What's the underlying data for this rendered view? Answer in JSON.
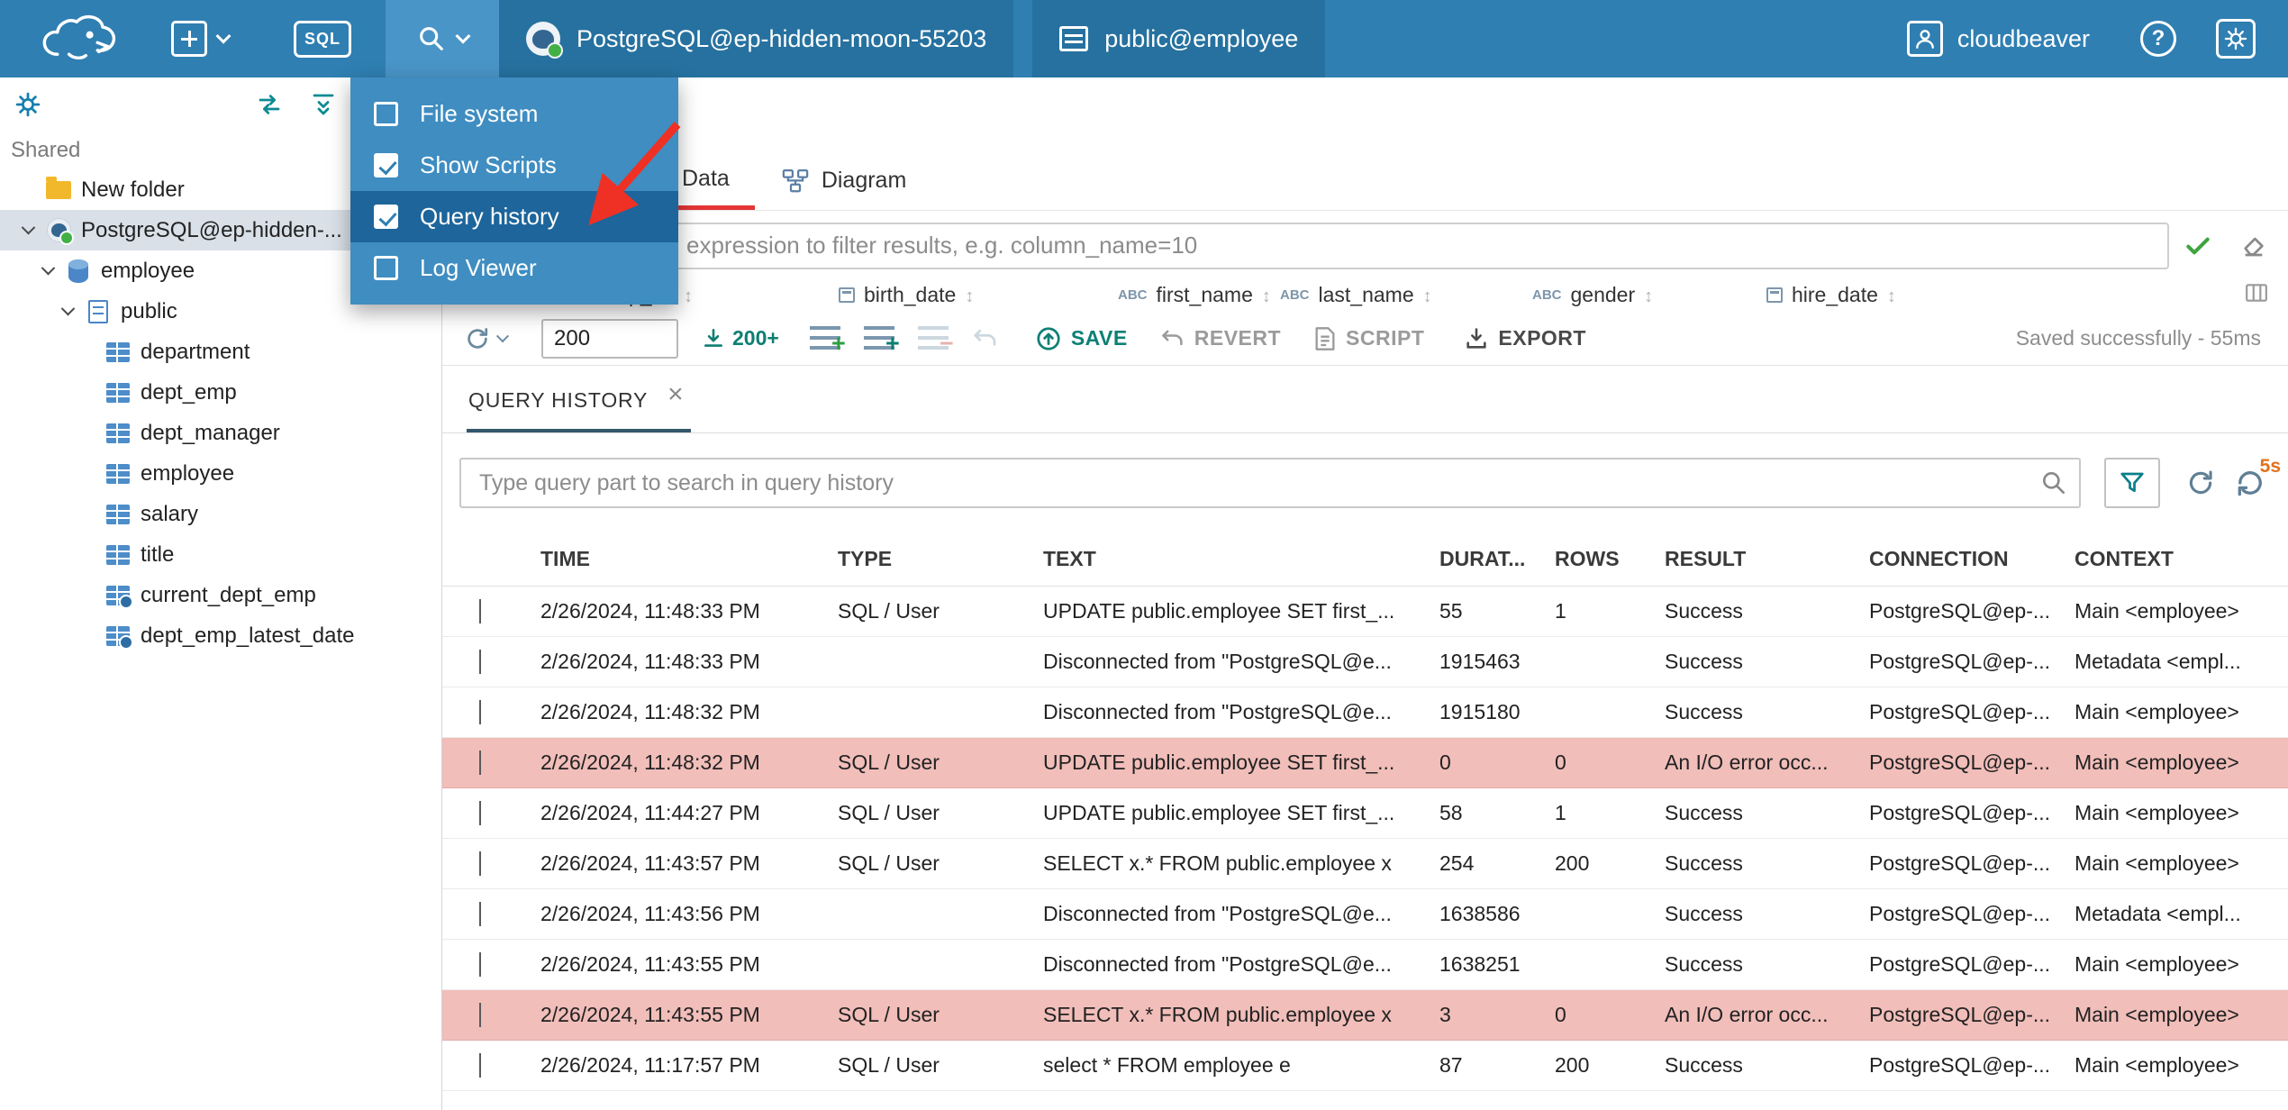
{
  "colors": {
    "topbar": "#2f7fb2",
    "topbar_active_segment": "#26719f",
    "menu_highlight": "#1d659b",
    "active_tab_underline": "#e53535",
    "teal_accent": "#0e8074",
    "error_row_background": "#f1beba",
    "annotation_arrow": "#ee3124"
  },
  "topbar": {
    "sql_button": "SQL",
    "connection_label": "PostgreSQL@ep-hidden-moon-55203",
    "schema_label": "public@employee",
    "username": "cloudbeaver",
    "help": "?"
  },
  "menu": {
    "items": [
      {
        "label": "File system",
        "checked": false,
        "highlighted": false
      },
      {
        "label": "Show Scripts",
        "checked": true,
        "highlighted": false
      },
      {
        "label": "Query history",
        "checked": true,
        "highlighted": true
      },
      {
        "label": "Log Viewer",
        "checked": false,
        "highlighted": false
      }
    ]
  },
  "sidebar": {
    "section": "Shared",
    "tree": [
      {
        "label": "New folder",
        "icon": "folder",
        "level": 0,
        "chevron": false,
        "selected": false
      },
      {
        "label": "PostgreSQL@ep-hidden-...",
        "icon": "postgres",
        "level": 0,
        "chevron": true,
        "selected": true
      },
      {
        "label": "employee",
        "icon": "database",
        "level": 1,
        "chevron": true,
        "selected": false
      },
      {
        "label": "public",
        "icon": "schema",
        "level": 2,
        "chevron": true,
        "selected": false
      },
      {
        "label": "department",
        "icon": "table",
        "level": 3,
        "chevron": false,
        "selected": false
      },
      {
        "label": "dept_emp",
        "icon": "table",
        "level": 3,
        "chevron": false,
        "selected": false
      },
      {
        "label": "dept_manager",
        "icon": "table",
        "level": 3,
        "chevron": false,
        "selected": false
      },
      {
        "label": "employee",
        "icon": "table",
        "level": 3,
        "chevron": false,
        "selected": false
      },
      {
        "label": "salary",
        "icon": "table",
        "level": 3,
        "chevron": false,
        "selected": false
      },
      {
        "label": "title",
        "icon": "table",
        "level": 3,
        "chevron": false,
        "selected": false
      },
      {
        "label": "current_dept_emp",
        "icon": "view",
        "level": 3,
        "chevron": false,
        "selected": false
      },
      {
        "label": "dept_emp_latest_date",
        "icon": "view",
        "level": 3,
        "chevron": false,
        "selected": false
      }
    ]
  },
  "tabs": {
    "data": "Data",
    "diagram": "Diagram"
  },
  "filter": {
    "placeholder": "expression to filter results, e.g. column_name=10"
  },
  "result_grid": {
    "row_number_header": "#",
    "columns": [
      {
        "name": "emp_no",
        "type": "num"
      },
      {
        "name": "birth_date",
        "type": "date"
      },
      {
        "name": "first_name",
        "type": "text"
      },
      {
        "name": "last_name",
        "type": "text"
      },
      {
        "name": "gender",
        "type": "text"
      },
      {
        "name": "hire_date",
        "type": "date"
      }
    ]
  },
  "toolbar": {
    "limit_value": "200",
    "fetch_more": "200+",
    "save": "SAVE",
    "revert": "REVERT",
    "script": "SCRIPT",
    "export": "EXPORT",
    "status": "Saved successfully - 55ms"
  },
  "history": {
    "tab_label": "QUERY HISTORY",
    "close_icon": "×",
    "search_placeholder": "Type query part to search in query history",
    "refresh_badge": "5s",
    "columns": [
      "TIME",
      "TYPE",
      "TEXT",
      "DURAT...",
      "ROWS",
      "RESULT",
      "CONNECTION",
      "CONTEXT"
    ],
    "rows": [
      {
        "time": "2/26/2024, 11:48:33 PM",
        "type": "SQL / User",
        "text": "UPDATE public.employee SET first_...",
        "duration": "55",
        "rows": "1",
        "result": "Success",
        "connection": "PostgreSQL@ep-...",
        "context": "Main <employee>",
        "error": false
      },
      {
        "time": "2/26/2024, 11:48:33 PM",
        "type": "",
        "text": "Disconnected from \"PostgreSQL@e...",
        "duration": "1915463",
        "rows": "",
        "result": "Success",
        "connection": "PostgreSQL@ep-...",
        "context": "Metadata <empl...",
        "error": false
      },
      {
        "time": "2/26/2024, 11:48:32 PM",
        "type": "",
        "text": "Disconnected from \"PostgreSQL@e...",
        "duration": "1915180",
        "rows": "",
        "result": "Success",
        "connection": "PostgreSQL@ep-...",
        "context": "Main <employee>",
        "error": false
      },
      {
        "time": "2/26/2024, 11:48:32 PM",
        "type": "SQL / User",
        "text": "UPDATE public.employee SET first_...",
        "duration": "0",
        "rows": "0",
        "result": "An I/O error occ...",
        "connection": "PostgreSQL@ep-...",
        "context": "Main <employee>",
        "error": true
      },
      {
        "time": "2/26/2024, 11:44:27 PM",
        "type": "SQL / User",
        "text": "UPDATE public.employee SET first_...",
        "duration": "58",
        "rows": "1",
        "result": "Success",
        "connection": "PostgreSQL@ep-...",
        "context": "Main <employee>",
        "error": false
      },
      {
        "time": "2/26/2024, 11:43:57 PM",
        "type": "SQL / User",
        "text": "SELECT x.* FROM public.employee x",
        "duration": "254",
        "rows": "200",
        "result": "Success",
        "connection": "PostgreSQL@ep-...",
        "context": "Main <employee>",
        "error": false
      },
      {
        "time": "2/26/2024, 11:43:56 PM",
        "type": "",
        "text": "Disconnected from \"PostgreSQL@e...",
        "duration": "1638586",
        "rows": "",
        "result": "Success",
        "connection": "PostgreSQL@ep-...",
        "context": "Metadata <empl...",
        "error": false
      },
      {
        "time": "2/26/2024, 11:43:55 PM",
        "type": "",
        "text": "Disconnected from \"PostgreSQL@e...",
        "duration": "1638251",
        "rows": "",
        "result": "Success",
        "connection": "PostgreSQL@ep-...",
        "context": "Main <employee>",
        "error": false
      },
      {
        "time": "2/26/2024, 11:43:55 PM",
        "type": "SQL / User",
        "text": "SELECT x.* FROM public.employee x",
        "duration": "3",
        "rows": "0",
        "result": "An I/O error occ...",
        "connection": "PostgreSQL@ep-...",
        "context": "Main <employee>",
        "error": true
      },
      {
        "time": "2/26/2024, 11:17:57 PM",
        "type": "SQL / User",
        "text": "select * FROM employee e",
        "duration": "87",
        "rows": "200",
        "result": "Success",
        "connection": "PostgreSQL@ep-...",
        "context": "Main <employee>",
        "error": false
      }
    ]
  }
}
